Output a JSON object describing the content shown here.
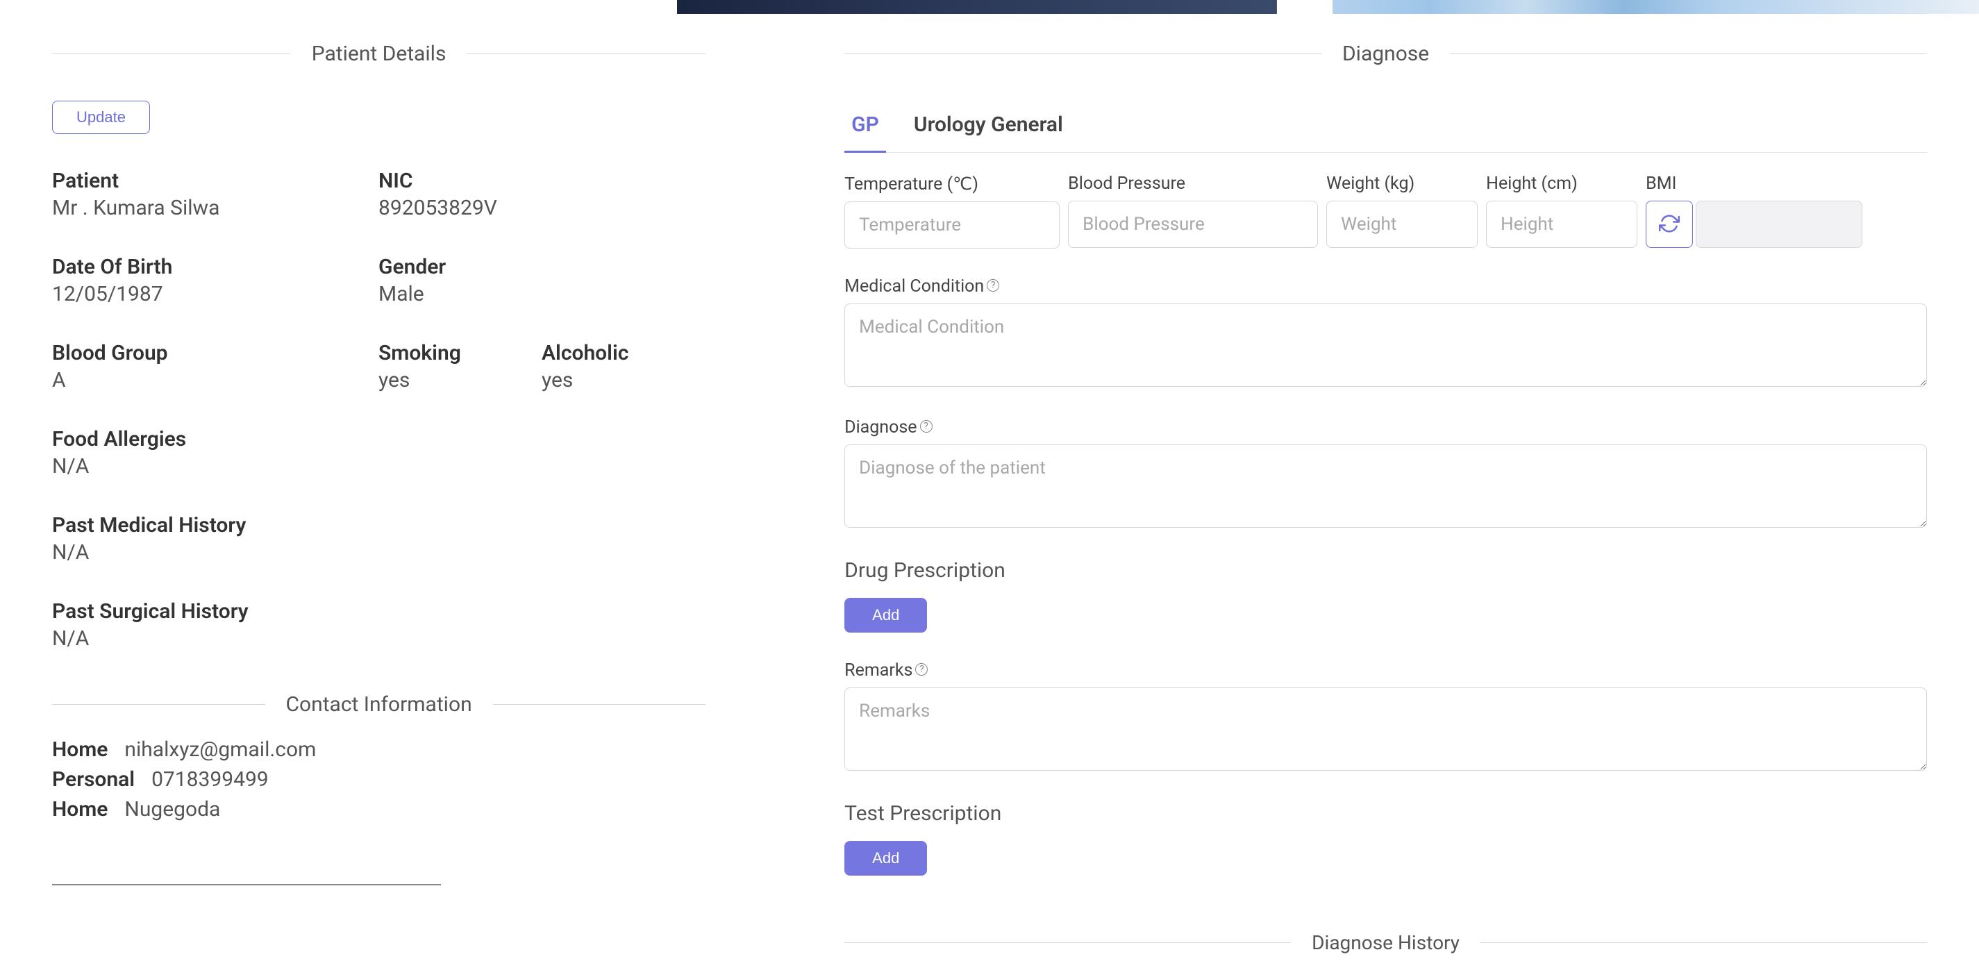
{
  "left": {
    "section_title": "Patient Details",
    "update_label": "Update",
    "patient_label": "Patient",
    "patient_value": "Mr . Kumara Silwa",
    "nic_label": "NIC",
    "nic_value": "892053829V",
    "dob_label": "Date Of Birth",
    "dob_value": "12/05/1987",
    "gender_label": "Gender",
    "gender_value": "Male",
    "blood_label": "Blood Group",
    "blood_value": "A",
    "smoking_label": "Smoking",
    "smoking_value": "yes",
    "alcoholic_label": "Alcoholic",
    "alcoholic_value": "yes",
    "allergies_label": "Food Allergies",
    "allergies_value": "N/A",
    "pmh_label": "Past Medical History",
    "pmh_value": "N/A",
    "psh_label": "Past Surgical History",
    "psh_value": "N/A",
    "contact_title": "Contact Information",
    "contact": [
      {
        "label": "Home",
        "value": "nihalxyz@gmail.com"
      },
      {
        "label": "Personal",
        "value": "0718399499"
      },
      {
        "label": "Home",
        "value": "Nugegoda"
      }
    ]
  },
  "right": {
    "section_title": "Diagnose",
    "tabs": [
      {
        "label": "GP",
        "active": true
      },
      {
        "label": "Urology General",
        "active": false
      }
    ],
    "vitals": {
      "temperature_label": "Temperature (℃)",
      "temperature_placeholder": "Temperature",
      "bp_label": "Blood Pressure",
      "bp_placeholder": "Blood Pressure",
      "weight_label": "Weight (kg)",
      "weight_placeholder": "Weight",
      "height_label": "Height (cm)",
      "height_placeholder": "Height",
      "bmi_label": "BMI"
    },
    "medical_condition_label": "Medical Condition",
    "medical_condition_placeholder": "Medical Condition",
    "diagnose_label": "Diagnose",
    "diagnose_placeholder": "Diagnose of the patient",
    "drug_prescription_heading": "Drug Prescription",
    "add_label": "Add",
    "remarks_label": "Remarks",
    "remarks_placeholder": "Remarks",
    "test_prescription_heading": "Test Prescription",
    "history_title": "Diagnose History"
  }
}
